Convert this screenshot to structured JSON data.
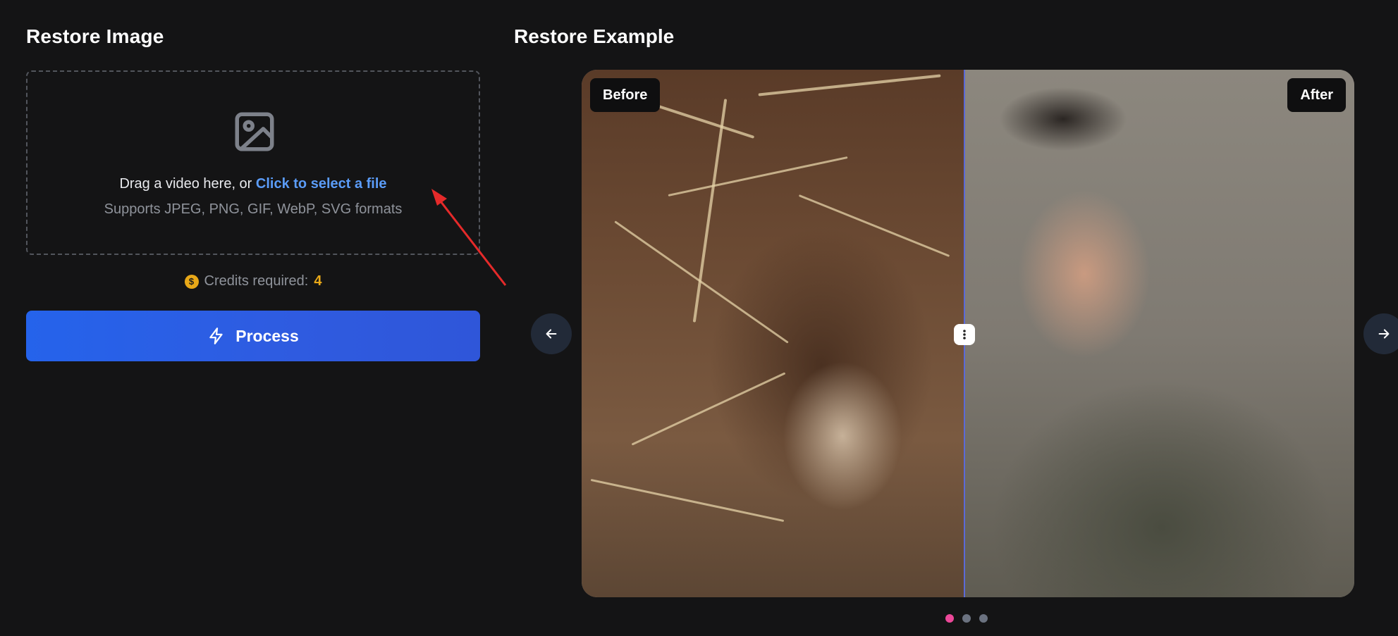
{
  "left": {
    "title": "Restore Image",
    "dropzone": {
      "text_prefix": "Drag a video here, or",
      "link_text": "Click to select a file",
      "formats": "Supports JPEG, PNG, GIF, WebP, SVG formats",
      "icon": "image-icon"
    },
    "credits": {
      "label": "Credits required:",
      "value": "4",
      "icon": "coin-icon"
    },
    "process_button": {
      "label": "Process",
      "icon": "lightning-icon"
    }
  },
  "right": {
    "title": "Restore Example",
    "before_label": "Before",
    "after_label": "After",
    "prev_icon": "arrow-left-icon",
    "next_icon": "arrow-right-icon",
    "slides": {
      "count": 3,
      "active": 1
    }
  },
  "colors": {
    "background": "#141415",
    "accent_blue": "#2563eb",
    "link_blue": "#5b9cf8",
    "credits_gold": "#e8a818",
    "active_dot": "#ec4899",
    "annotation_red": "#e52a2a"
  }
}
